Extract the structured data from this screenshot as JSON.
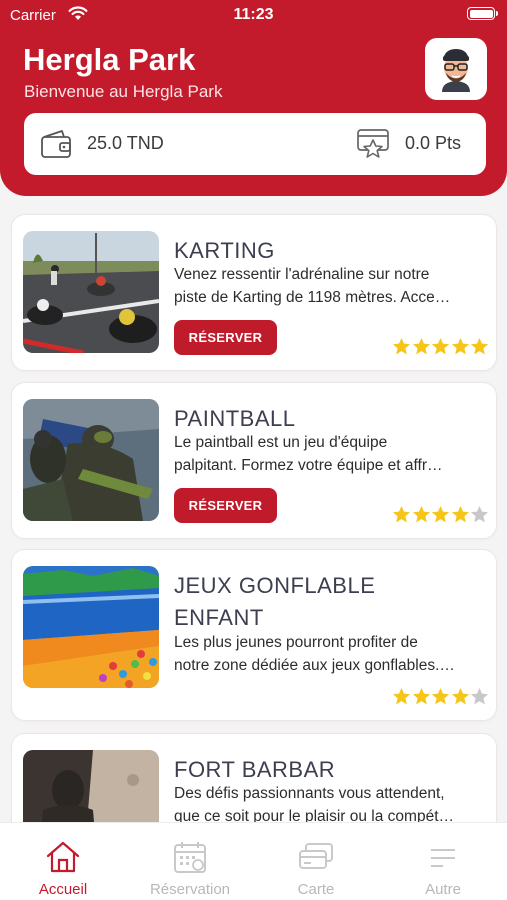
{
  "status_bar": {
    "carrier": "Carrier",
    "time": "11:23"
  },
  "header": {
    "title": "Hergla Park",
    "subtitle": "Bienvenue au Hergla Park",
    "avatar_icon": "memoji-avatar-icon"
  },
  "wallet": {
    "balance": "25.0 TND",
    "points": "0.0 Pts",
    "wallet_icon": "wallet-icon",
    "loyalty_icon": "loyalty-card-icon"
  },
  "colors": {
    "primary": "#c41b2c",
    "star": "#f5c518",
    "star_empty": "#c8c8c8",
    "title": "#3d3f51"
  },
  "activities": [
    {
      "title_lines": [
        "KARTING"
      ],
      "desc_lines": [
        "Venez ressentir l'adrénaline sur notre",
        "piste de Karting de 1198 mètres. Acce…"
      ],
      "button": "RÉSERVER",
      "rating": 5,
      "max_rating": 5
    },
    {
      "title_lines": [
        "PAINTBALL"
      ],
      "desc_lines": [
        "Le paintball est un jeu d'équipe",
        "palpitant. Formez votre équipe et affr…"
      ],
      "button": "RÉSERVER",
      "rating": 4,
      "max_rating": 5
    },
    {
      "title_lines": [
        "JEUX GONFLABLE",
        "ENFANT"
      ],
      "desc_lines": [
        "Les plus jeunes pourront profiter de",
        "notre zone dédiée aux jeux gonflables.…"
      ],
      "button": null,
      "rating": 4,
      "max_rating": 5
    },
    {
      "title_lines": [
        "FORT BARBAR"
      ],
      "desc_lines": [
        "Des défis passionnants vous attendent,",
        "que ce soit pour le plaisir ou la compét…"
      ],
      "button": null,
      "rating": null,
      "max_rating": 5
    }
  ],
  "tabs": [
    {
      "label": "Accueil",
      "icon": "home-icon",
      "active": true
    },
    {
      "label": "Réservation",
      "icon": "calendar-icon",
      "active": false
    },
    {
      "label": "Carte",
      "icon": "cards-icon",
      "active": false
    },
    {
      "label": "Autre",
      "icon": "menu-icon",
      "active": false
    }
  ]
}
